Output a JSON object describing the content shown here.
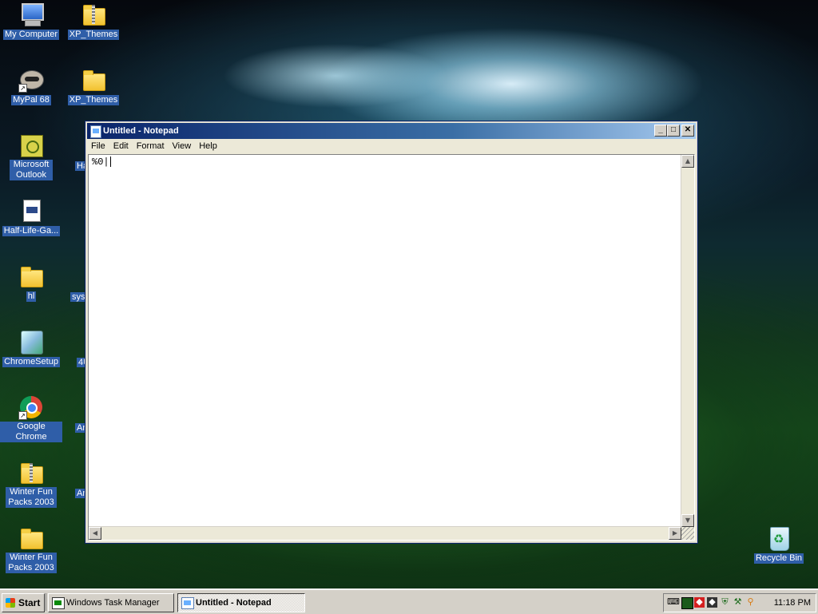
{
  "desktop": {
    "icons": [
      {
        "label": "My Computer"
      },
      {
        "label": "XP_Themes"
      },
      {
        "label": "MyPal 68"
      },
      {
        "label": "XP_Themes"
      },
      {
        "label": "Microsoft Outlook"
      },
      {
        "label": "Half-Life-Ga..."
      },
      {
        "label": "hl"
      },
      {
        "label": "ChromeSetup"
      },
      {
        "label": "Google Chrome"
      },
      {
        "label": "Winter Fun Packs 2003"
      },
      {
        "label": "Winter Fun Packs 2003"
      },
      {
        "label": "Recycle Bin"
      }
    ],
    "partial_labels": [
      "Ha",
      "sys",
      "4U",
      "An",
      "An"
    ]
  },
  "notepad": {
    "title": "Untitled - Notepad",
    "menu": [
      "File",
      "Edit",
      "Format",
      "View",
      "Help"
    ],
    "content": "%0|"
  },
  "taskbar": {
    "start_label": "Start",
    "tasks": [
      {
        "label": "Windows Task Manager",
        "active": false
      },
      {
        "label": "Untitled - Notepad",
        "active": true
      }
    ],
    "clock": "11:18 PM"
  },
  "colors": {
    "title_active": "#0a246a",
    "desktop_label_bg": "#2f5ea8",
    "taskbar_bg": "#d4d0c8"
  }
}
